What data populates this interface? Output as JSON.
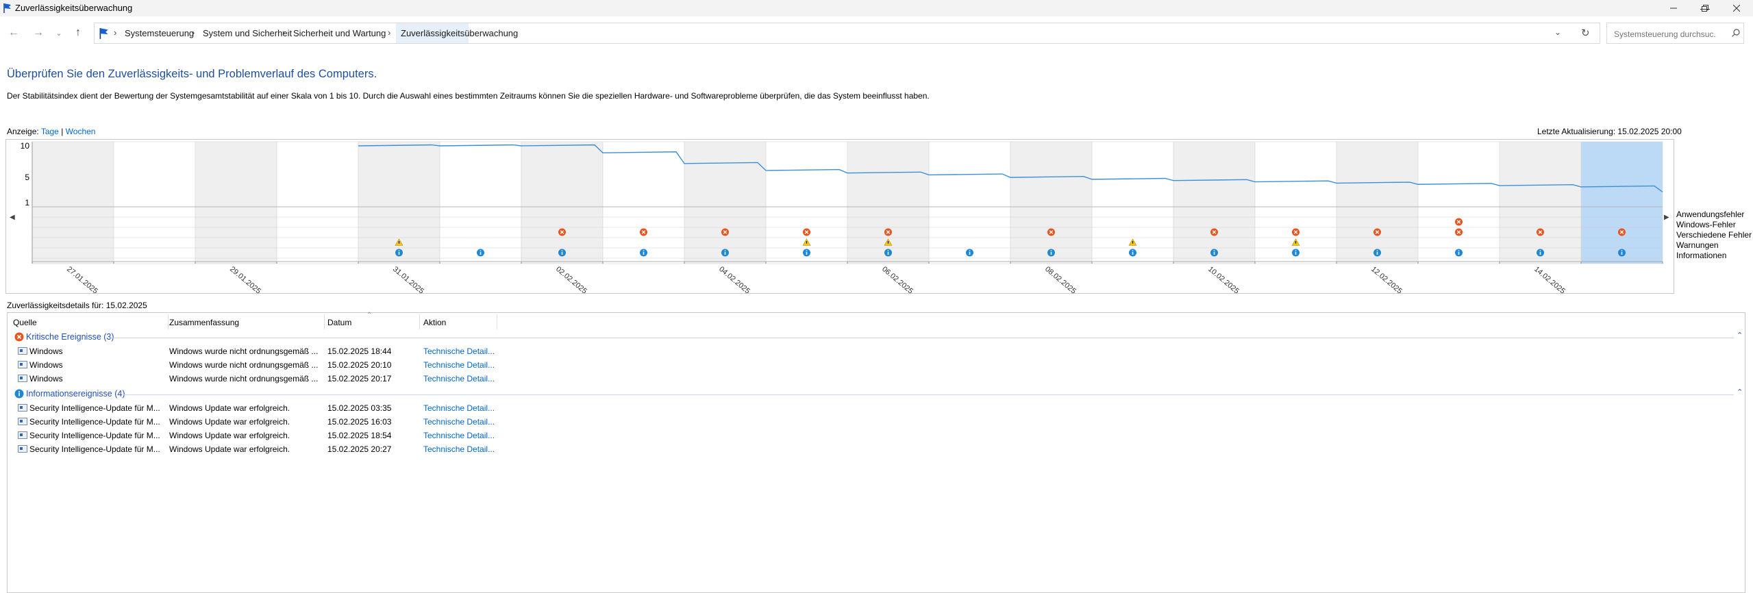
{
  "window": {
    "title": "Zuverlässigkeitsüberwachung",
    "controls": [
      "minimize-icon",
      "restore-icon",
      "close-icon"
    ]
  },
  "nav": {
    "breadcrumbs": [
      "Systemsteuerung",
      "System und Sicherheit",
      "Sicherheit und Wartung",
      "Zuverlässigkeitsüberwachung"
    ],
    "search_placeholder": "Systemsteuerung durchsuc..."
  },
  "page": {
    "heading": "Überprüfen Sie den Zuverlässigkeits- und Problemverlauf des Computers.",
    "description": "Der Stabilitätsindex dient der Bewertung der Systemgesamtstabilität auf einer Skala von 1 bis 10. Durch die Auswahl eines bestimmten Zeitraums können Sie die speziellen Hardware- und Softwareprobleme überprüfen, die das System beeinflusst haben.",
    "view_label": "Anzeige:",
    "view_days": "Tage",
    "view_separator": "|",
    "view_weeks": "Wochen",
    "last_update": "Letzte Aktualisierung: 15.02.2025 20:00"
  },
  "chart": {
    "y_ticks": [
      "10",
      "5",
      "1"
    ],
    "categories": [
      "Anwendungsfehler",
      "Windows-Fehler",
      "Verschiedene Fehler",
      "Warnungen",
      "Informationen"
    ],
    "date_labels": [
      "27.01.2025",
      "29.01.2025",
      "31.01.2025",
      "02.02.2025",
      "04.02.2025",
      "06.02.2025",
      "08.02.2025",
      "10.02.2025",
      "12.02.2025",
      "14.02.2025"
    ],
    "day_count": 20,
    "selected_day": 19,
    "colors": {
      "line": "#3f8fd8",
      "error": "#e8541e",
      "warning": "#f5c518",
      "info": "#1e88d6",
      "selected": "#bcd9f5",
      "shaded": "#efefef"
    },
    "stability_index": [
      null,
      null,
      null,
      null,
      10,
      10,
      10,
      8.9,
      7.2,
      6.1,
      5.7,
      5.4,
      5.0,
      4.7,
      4.5,
      4.3,
      4.1,
      3.9,
      3.7,
      3.5
    ],
    "events": {
      "app_error": [],
      "windows_error": [
        17
      ],
      "misc_error": [
        6,
        7,
        8,
        9,
        10,
        12,
        14,
        15,
        16,
        17,
        18,
        19
      ],
      "warning": [
        4,
        9,
        10,
        13,
        15
      ],
      "info": [
        4,
        5,
        6,
        7,
        8,
        9,
        10,
        11,
        12,
        13,
        14,
        15,
        16,
        17,
        18,
        19
      ]
    }
  },
  "details": {
    "title": "Zuverlässigkeitsdetails für: 15.02.2025",
    "columns": [
      "Quelle",
      "Zusammenfassung",
      "Datum",
      "Aktion"
    ],
    "groups": [
      {
        "label": "Kritische Ereignisse (3)",
        "type": "error",
        "rows": [
          {
            "source": "Windows",
            "summary": "Windows wurde nicht ordnungsgemäß ...",
            "date": "15.02.2025 18:44",
            "action": "Technische Detail..."
          },
          {
            "source": "Windows",
            "summary": "Windows wurde nicht ordnungsgemäß ...",
            "date": "15.02.2025 20:10",
            "action": "Technische Detail..."
          },
          {
            "source": "Windows",
            "summary": "Windows wurde nicht ordnungsgemäß ...",
            "date": "15.02.2025 20:17",
            "action": "Technische Detail..."
          }
        ]
      },
      {
        "label": "Informationsereignisse (4)",
        "type": "info",
        "rows": [
          {
            "source": "Security Intelligence-Update für M...",
            "summary": "Windows Update war erfolgreich.",
            "date": "15.02.2025 03:35",
            "action": "Technische Detail..."
          },
          {
            "source": "Security Intelligence-Update für M...",
            "summary": "Windows Update war erfolgreich.",
            "date": "15.02.2025 16:03",
            "action": "Technische Detail..."
          },
          {
            "source": "Security Intelligence-Update für M...",
            "summary": "Windows Update war erfolgreich.",
            "date": "15.02.2025 18:54",
            "action": "Technische Detail..."
          },
          {
            "source": "Security Intelligence-Update für M...",
            "summary": "Windows Update war erfolgreich.",
            "date": "15.02.2025 20:27",
            "action": "Technische Detail..."
          }
        ]
      }
    ]
  }
}
